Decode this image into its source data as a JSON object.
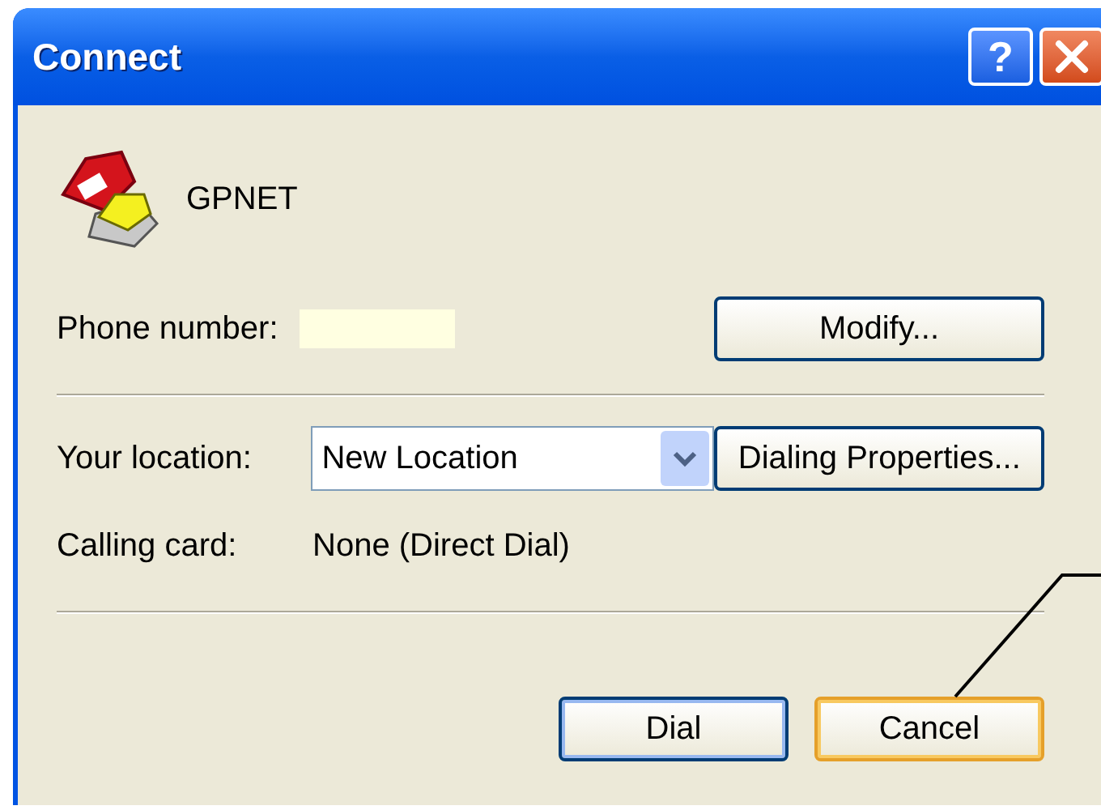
{
  "window": {
    "title": "Connect",
    "title_buttons": [
      {
        "kind": "help",
        "label": "?"
      },
      {
        "kind": "close"
      }
    ]
  },
  "connection": {
    "name": "GPNET"
  },
  "phone_number": {
    "label": "Phone number:",
    "button": "Modify..."
  },
  "location": {
    "label": "Your location:",
    "value": "New Location",
    "button": "Dialing Properties..."
  },
  "calling_card": {
    "label": "Calling card:",
    "value": "None (Direct Dial)"
  },
  "buttons": [
    {
      "label": "Dial",
      "default": true,
      "hovered": false
    },
    {
      "label": "Cancel",
      "default": false,
      "hovered": true
    }
  ]
}
